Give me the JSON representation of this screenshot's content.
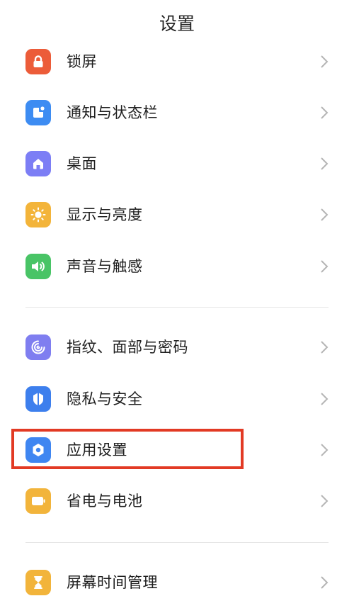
{
  "header": {
    "title": "设置"
  },
  "colors": {
    "lock": "#ec5c39",
    "notification": "#3d8cf2",
    "desktop": "#7c7ef5",
    "display": "#f3b43a",
    "sound": "#49c466",
    "fingerprint": "#7f7ef0",
    "privacy": "#3d7fed",
    "apps": "#3f86f1",
    "battery": "#f2b43b",
    "screen_time": "#f2b43b",
    "highlight": "#e23a24"
  },
  "groups": [
    {
      "items": [
        {
          "label": "锁屏",
          "icon": "lock-icon"
        },
        {
          "label": "通知与状态栏",
          "icon": "notification-icon"
        },
        {
          "label": "桌面",
          "icon": "home-icon"
        },
        {
          "label": "显示与亮度",
          "icon": "sun-icon"
        },
        {
          "label": "声音与触感",
          "icon": "speaker-icon"
        }
      ]
    },
    {
      "items": [
        {
          "label": "指纹、面部与密码",
          "icon": "fingerprint-icon"
        },
        {
          "label": "隐私与安全",
          "icon": "privacy-shield-icon"
        },
        {
          "label": "应用设置",
          "icon": "hexagon-settings-icon",
          "highlighted": true
        },
        {
          "label": "省电与电池",
          "icon": "battery-icon"
        }
      ]
    },
    {
      "items": [
        {
          "label": "屏幕时间管理",
          "icon": "hourglass-icon"
        }
      ]
    }
  ]
}
